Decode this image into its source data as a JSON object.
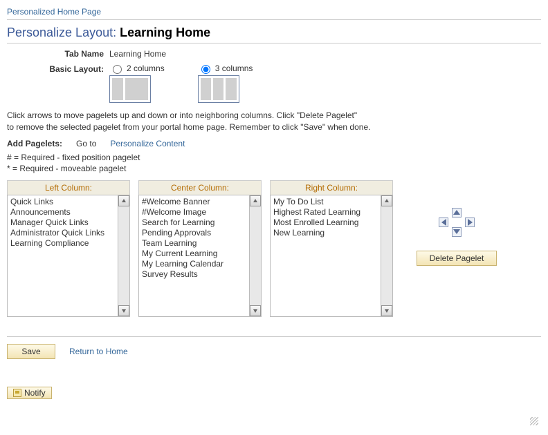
{
  "breadcrumb": "Personalized Home Page",
  "title_lead": "Personalize Layout:",
  "title_sub": "Learning Home",
  "tab_name_label": "Tab Name",
  "tab_name_value": "Learning Home",
  "basic_layout_label": "Basic Layout:",
  "layout_options": {
    "two": "2 columns",
    "three": "3 columns",
    "selected": "three"
  },
  "instructions_line1": "Click arrows to move pagelets up and down or into neighboring columns. Click \"Delete Pagelet\"",
  "instructions_line2": "to remove the selected pagelet from your portal home page. Remember to click \"Save\" when done.",
  "add_pagelets_label": "Add Pagelets:",
  "goto_label": "Go to",
  "personalize_content_link": "Personalize Content",
  "legend_fixed": "# = Required - fixed position pagelet",
  "legend_move": "* = Required - moveable pagelet",
  "columns": {
    "left": {
      "header": "Left Column:",
      "items": [
        "Quick Links",
        "Announcements",
        "Manager Quick Links",
        "Administrator Quick Links",
        "Learning Compliance"
      ]
    },
    "center": {
      "header": "Center Column:",
      "items": [
        "#Welcome Banner",
        "#Welcome Image",
        "Search for Learning",
        "Pending Approvals",
        "Team Learning",
        "My Current Learning",
        "My Learning Calendar",
        "Survey Results"
      ]
    },
    "right": {
      "header": "Right Column:",
      "items": [
        "My To Do List",
        "Highest Rated Learning",
        "Most Enrolled Learning",
        "New Learning"
      ]
    }
  },
  "delete_pagelet_label": "Delete Pagelet",
  "save_label": "Save",
  "return_home_label": "Return to Home",
  "notify_label": "Notify"
}
